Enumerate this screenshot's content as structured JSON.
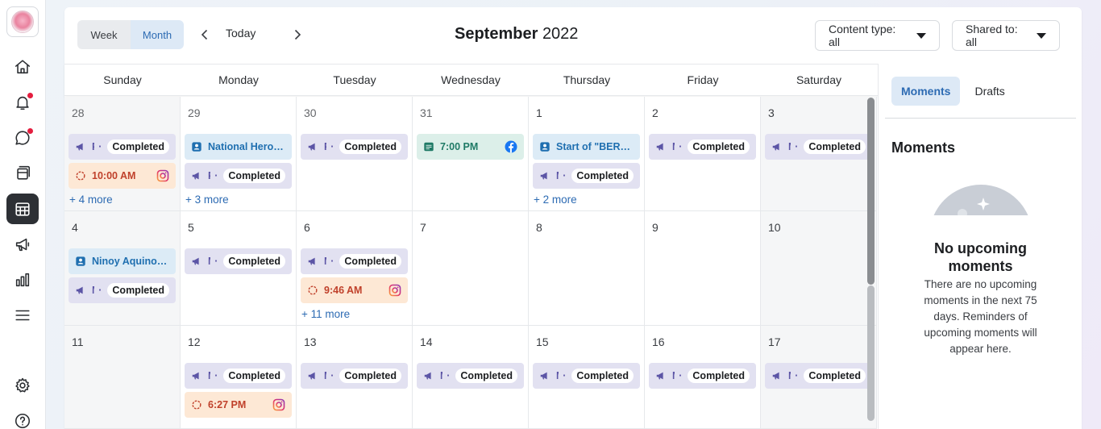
{
  "rail": {
    "items": [
      {
        "name": "home-icon"
      },
      {
        "name": "notifications-icon",
        "badge": true
      },
      {
        "name": "messages-icon",
        "badge": true
      },
      {
        "name": "content-icon"
      },
      {
        "name": "calendar-icon",
        "active": true
      },
      {
        "name": "ads-icon"
      },
      {
        "name": "insights-icon"
      },
      {
        "name": "all-tools-icon"
      },
      {
        "name": "settings-icon"
      },
      {
        "name": "help-icon"
      }
    ]
  },
  "toolbar": {
    "week_label": "Week",
    "month_label": "Month",
    "today_label": "Today",
    "month_name": "September",
    "year": "2022",
    "content_type": "Content type: all",
    "shared_to": "Shared to: all"
  },
  "weekdays": [
    "Sunday",
    "Monday",
    "Tuesday",
    "Wednesday",
    "Thursday",
    "Friday",
    "Saturday"
  ],
  "weeks": [
    [
      {
        "day": "28",
        "shaded": true,
        "events": [
          {
            "kind": "post",
            "label": "Po…",
            "status": "Completed"
          },
          {
            "kind": "story",
            "label": "10:00 AM",
            "platform": "instagram"
          }
        ],
        "more": "+ 4 more"
      },
      {
        "day": "29",
        "events": [
          {
            "kind": "moment",
            "label": "National Heroe…"
          },
          {
            "kind": "post",
            "label": "Po…",
            "status": "Completed"
          }
        ],
        "more": "+ 3 more"
      },
      {
        "day": "30",
        "events": [
          {
            "kind": "post",
            "label": "Po…",
            "status": "Completed"
          }
        ]
      },
      {
        "day": "31",
        "events": [
          {
            "kind": "fb",
            "label": "7:00 PM",
            "platform": "facebook"
          }
        ]
      },
      {
        "day": "1",
        "events": [
          {
            "kind": "moment",
            "label": "Start of \"BER\"…"
          },
          {
            "kind": "post",
            "label": "Mess",
            "status": "Completed"
          }
        ],
        "more": "+ 2 more"
      },
      {
        "day": "2",
        "events": [
          {
            "kind": "post",
            "label": "Mess",
            "status": "Completed"
          }
        ]
      },
      {
        "day": "3",
        "shaded": true,
        "events": [
          {
            "kind": "post",
            "label": "Mess",
            "status": "Completed"
          }
        ]
      }
    ],
    [
      {
        "day": "4",
        "shaded": true,
        "events": [
          {
            "kind": "moment",
            "label": "Ninoy Aquino…"
          },
          {
            "kind": "post",
            "label": "Mess",
            "status": "Completed"
          }
        ]
      },
      {
        "day": "5",
        "events": [
          {
            "kind": "post",
            "label": "Mess",
            "status": "Completed"
          }
        ]
      },
      {
        "day": "6",
        "events": [
          {
            "kind": "post",
            "label": "Mess",
            "status": "Completed"
          },
          {
            "kind": "story",
            "label": "9:46 AM",
            "platform": "instagram"
          }
        ],
        "more": "+ 11 more"
      },
      {
        "day": "7",
        "events": []
      },
      {
        "day": "8",
        "events": []
      },
      {
        "day": "9",
        "events": []
      },
      {
        "day": "10",
        "shaded": true,
        "events": []
      }
    ],
    [
      {
        "day": "11",
        "shaded": true,
        "events": []
      },
      {
        "day": "12",
        "events": [
          {
            "kind": "post",
            "label": "Mess",
            "status": "Completed"
          },
          {
            "kind": "story",
            "label": "6:27 PM",
            "platform": "instagram"
          }
        ]
      },
      {
        "day": "13",
        "events": [
          {
            "kind": "post",
            "label": "Mess",
            "status": "Completed"
          }
        ]
      },
      {
        "day": "14",
        "events": [
          {
            "kind": "post",
            "label": "Mess",
            "status": "Completed"
          }
        ]
      },
      {
        "day": "15",
        "events": [
          {
            "kind": "post",
            "label": "Mess",
            "status": "Completed"
          }
        ]
      },
      {
        "day": "16",
        "events": [
          {
            "kind": "post",
            "label": "Mess",
            "status": "Completed"
          }
        ]
      },
      {
        "day": "17",
        "shaded": true,
        "events": [
          {
            "kind": "post",
            "label": "Mess",
            "status": "Completed"
          }
        ]
      }
    ]
  ],
  "side": {
    "tab_moments": "Moments",
    "tab_drafts": "Drafts",
    "heading": "Moments",
    "empty_title": "No upcoming moments",
    "empty_text": "There are no upcoming moments in the next 75 days. Reminders of upcoming moments will appear here."
  },
  "colors": {
    "accent": "#2d6bb3",
    "post_bg": "#e2e1f1",
    "moment_bg": "#dcebf6",
    "story_bg": "#fde8d5",
    "fb_bg": "#dcefe9"
  }
}
